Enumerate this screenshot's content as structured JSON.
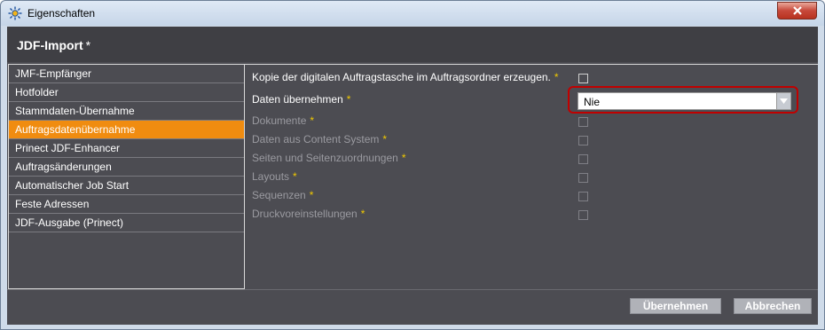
{
  "window": {
    "title": "Eigenschaften"
  },
  "panel": {
    "title": "JDF-Import",
    "title_marker": "*"
  },
  "nav": {
    "items": [
      {
        "label": "JMF-Empfänger",
        "active": false
      },
      {
        "label": "Hotfolder",
        "active": false
      },
      {
        "label": "Stammdaten-Übernahme",
        "active": false
      },
      {
        "label": "Auftragsdatenübernahme",
        "active": true
      },
      {
        "label": "Prinect JDF-Enhancer",
        "active": false
      },
      {
        "label": "Auftragsänderungen",
        "active": false
      },
      {
        "label": "Automatischer Job Start",
        "active": false
      },
      {
        "label": "Feste Adressen",
        "active": false
      },
      {
        "label": "JDF-Ausgabe (Prinect)",
        "active": false
      }
    ]
  },
  "form": {
    "required_marker": "*",
    "kopie": {
      "label": "Kopie der digitalen Auftragstasche im Auftragsordner erzeugen.",
      "checked": false
    },
    "daten": {
      "label": "Daten übernehmen",
      "value": "Nie"
    },
    "options": [
      {
        "label": "Dokumente",
        "checked": false
      },
      {
        "label": "Daten aus Content System",
        "checked": false
      },
      {
        "label": "Seiten und Seitenzuordnungen",
        "checked": false
      },
      {
        "label": "Layouts",
        "checked": false
      },
      {
        "label": "Sequenzen",
        "checked": false
      },
      {
        "label": "Druckvoreinstellungen",
        "checked": false
      }
    ]
  },
  "footer": {
    "apply_label": "Übernehmen",
    "cancel_label": "Abbrechen"
  },
  "colors": {
    "accent": "#f08c10",
    "highlight": "#c00000",
    "required": "#f0c800"
  }
}
